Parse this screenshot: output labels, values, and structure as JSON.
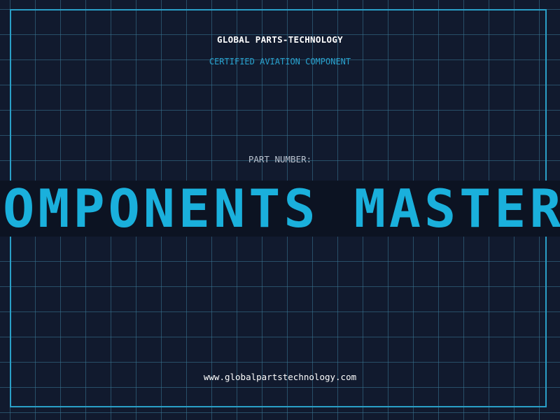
{
  "header": {
    "brand": "GLOBAL PARTS-TECHNOLOGY",
    "subtitle": "CERTIFIED AVIATION COMPONENT"
  },
  "part": {
    "label": "PART NUMBER:",
    "value": "COMPONENTS MASTER ELEMENT"
  },
  "footer": {
    "website": "www.globalpartstechnology.com"
  },
  "colors": {
    "background": "#111a2e",
    "grid": "#3a7896",
    "frame": "#2a9fc7",
    "accent": "#1ab0dc",
    "banner": "#0c1322"
  }
}
